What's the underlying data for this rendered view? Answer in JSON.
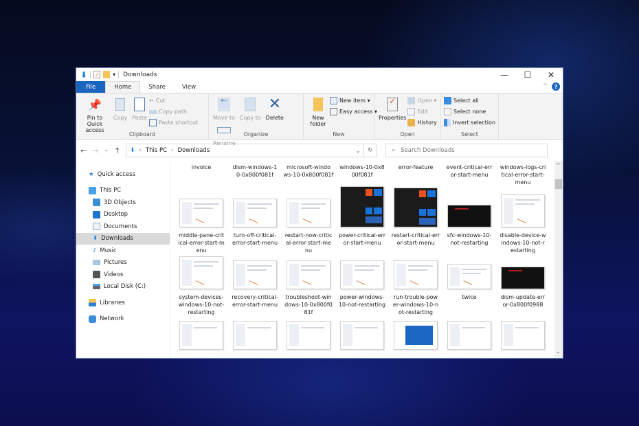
{
  "window": {
    "title": "Downloads",
    "controls": {
      "minimize": "—",
      "maximize": "☐",
      "close": "✕"
    }
  },
  "tabs": [
    {
      "label": "File"
    },
    {
      "label": "Home"
    },
    {
      "label": "Share"
    },
    {
      "label": "View"
    }
  ],
  "help_label": "?",
  "ribbon": {
    "clipboard": {
      "label": "Clipboard",
      "pin": "Pin to Quick access",
      "copy": "Copy",
      "paste": "Paste",
      "cut": "Cut",
      "copy_path": "Copy path",
      "paste_shortcut": "Paste shortcut"
    },
    "organize": {
      "label": "Organize",
      "move_to": "Move to",
      "copy_to": "Copy to",
      "delete": "Delete",
      "rename": "Rename"
    },
    "new": {
      "label": "New",
      "new_folder": "New folder",
      "new_item": "New item ▾",
      "easy_access": "Easy access ▾"
    },
    "open": {
      "label": "Open",
      "properties": "Properties",
      "open": "Open ▾",
      "edit": "Edit",
      "history": "History"
    },
    "select": {
      "label": "Select",
      "select_all": "Select all",
      "select_none": "Select none",
      "invert": "Invert selection"
    }
  },
  "address": {
    "crumbs": [
      "This PC",
      "Downloads"
    ],
    "search_placeholder": "Search Downloads"
  },
  "sidebar": {
    "items": [
      {
        "label": "Quick access",
        "icon": "star-icon"
      },
      {
        "label": "This PC",
        "icon": "computer-icon"
      },
      {
        "label": "3D Objects",
        "icon": "cube-icon"
      },
      {
        "label": "Desktop",
        "icon": "desktop-icon"
      },
      {
        "label": "Documents",
        "icon": "document-icon"
      },
      {
        "label": "Downloads",
        "icon": "download-icon",
        "selected": true
      },
      {
        "label": "Music",
        "icon": "music-icon"
      },
      {
        "label": "Pictures",
        "icon": "pictures-icon"
      },
      {
        "label": "Videos",
        "icon": "videos-icon"
      },
      {
        "label": "Local Disk (C:)",
        "icon": "disk-icon"
      },
      {
        "label": "Libraries",
        "icon": "libraries-icon"
      },
      {
        "label": "Network",
        "icon": "network-icon"
      }
    ]
  },
  "files": {
    "row1": [
      "invoice",
      "dism-windows-10-0x800f081f",
      "microsoft-windows-10-0x800f081f",
      "windows-10-0x800f081f",
      "error-feature",
      "event-critical-error-start-menu",
      "windows-logs-critical-error-start-menu"
    ],
    "row2": [
      "middle-pane-critical-error-start-menu",
      "turn-off-critical-error-start-menu",
      "restart-now-critical-error-start-menu",
      "power-critical-error-start-menu",
      "restart-critical-error-start-menu",
      "sfc-windows-10-not-restarting",
      "disable-device-windows-10-not-restarting"
    ],
    "row3": [
      "system-devices-windows-10-not-restarting",
      "recovery-critical-error-start-menu",
      "troubleshoot-windows-10-0x800f081f",
      "power-windows-10-not-restarting",
      "run-trouble-power-windows-10-not-restarting",
      "twice",
      "dism-update-error-0x800f0988"
    ]
  },
  "row1_display": [
    "invoice",
    "dism-windows-1\n0-0x800f081f",
    "microsoft-windo\nws-10-0x800f081f",
    "windows-10-0x8\n00f081f",
    "error-feature",
    "event-critical-err\nor-start-menu",
    "windows-logs-cri\ntical-error-start-\nmenu"
  ],
  "row2_display": [
    "middle-pane-crit\nical-error-start-m\nenu",
    "turn-off-critical-\nerror-start-menu",
    "restart-now-critic\nal-error-start-me\nnu",
    "power-critical-err\nor-start-menu",
    "restart-critical-err\nor-start-menu",
    "sfc-windows-10-\nnot-restarting",
    "disable-device-w\nindows-10-not-r\nestarting"
  ],
  "row3_display": [
    "system-devices-\nwindows-10-not-\nrestarting",
    "recovery-critical-\nerror-start-menu",
    "troubleshoot-win\ndows-10-0x800f0\n81f",
    "power-windows-\n10-not-restarting",
    "run-trouble-pow\ner-windows-10-n\not-restarting",
    "twice",
    "dism-update-err\nor-0x800f0988"
  ],
  "colors": {
    "accent": "#1a65c0",
    "selected": "#d9d9d9"
  }
}
